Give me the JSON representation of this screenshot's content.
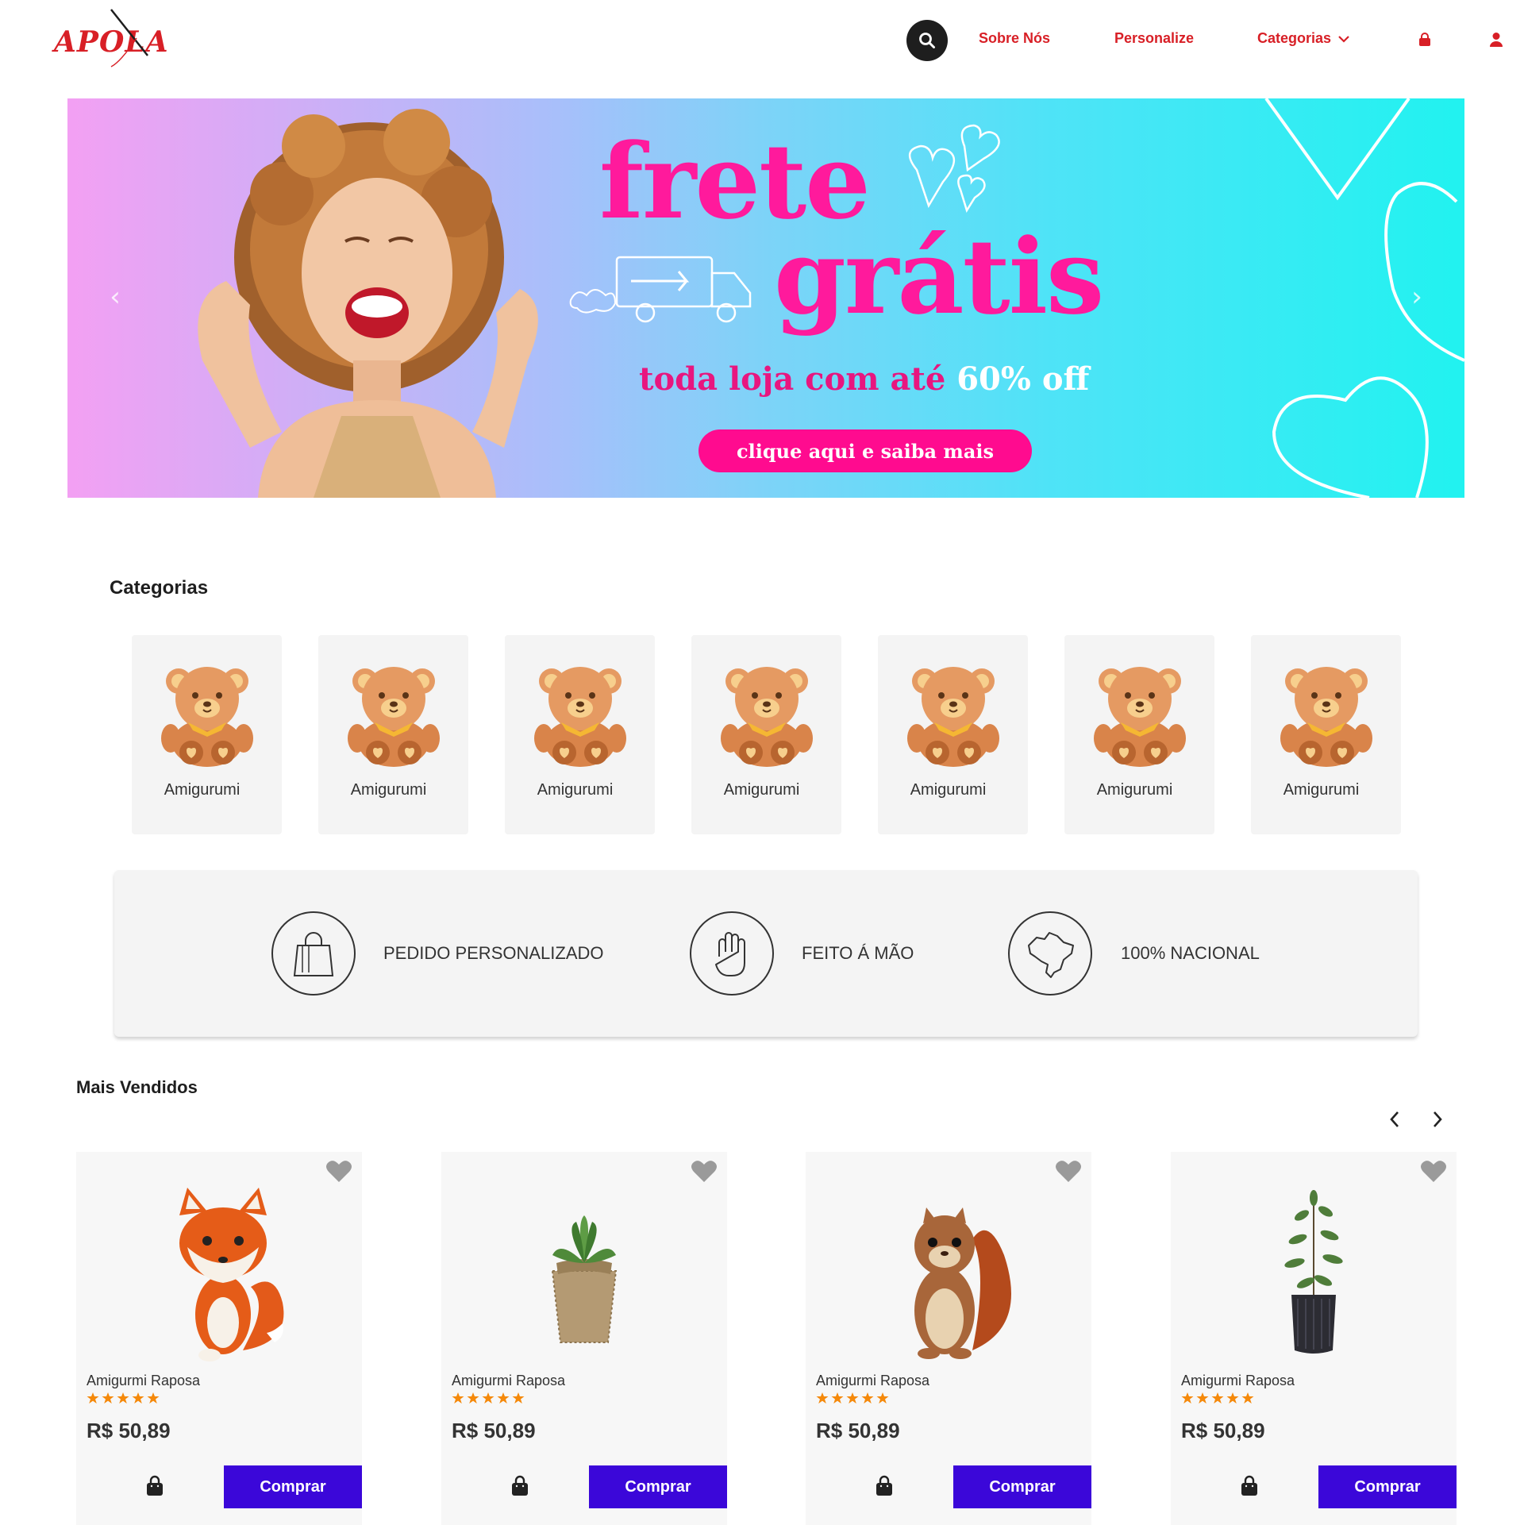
{
  "header": {
    "logo_text": "APOLA",
    "nav": {
      "about": "Sobre Nós",
      "customize": "Personalize",
      "categories": "Categorias"
    },
    "icons": [
      "search-icon",
      "cart-icon",
      "user-icon",
      "chevron-down-icon"
    ]
  },
  "banner": {
    "headline_1": "frete",
    "headline_2": "grátis",
    "subtitle_prefix": "toda loja com até ",
    "subtitle_highlight": "60% off",
    "cta": "clique aqui e saiba mais",
    "colors": {
      "pink": "#ff1a9c",
      "cyan": "#21f2f0",
      "lilac": "#f3a0f3"
    }
  },
  "categories": {
    "title": "Categorias",
    "items": [
      {
        "label": "Amigurumi"
      },
      {
        "label": "Amigurumi"
      },
      {
        "label": "Amigurumi"
      },
      {
        "label": "Amigurumi"
      },
      {
        "label": "Amigurumi"
      },
      {
        "label": "Amigurumi"
      },
      {
        "label": "Amigurumi"
      }
    ]
  },
  "features": [
    {
      "label": "PEDIDO PERSONALIZADO",
      "icon": "shopping-bag-icon"
    },
    {
      "label": "FEITO Á MÃO",
      "icon": "hand-icon"
    },
    {
      "label": "100% NACIONAL",
      "icon": "brazil-map-icon"
    }
  ],
  "best_sellers": {
    "title": "Mais Vendidos",
    "products": [
      {
        "name": "Amigurmi Raposa",
        "price": "R$ 50,89",
        "rating": 5,
        "buy": "Comprar",
        "image": "fox"
      },
      {
        "name": "Amigurmi Raposa",
        "price": "R$ 50,89",
        "rating": 5,
        "buy": "Comprar",
        "image": "succulent"
      },
      {
        "name": "Amigurmi Raposa",
        "price": "R$ 50,89",
        "rating": 5,
        "buy": "Comprar",
        "image": "squirrel"
      },
      {
        "name": "Amigurmi Raposa",
        "price": "R$ 50,89",
        "rating": 5,
        "buy": "Comprar",
        "image": "plant"
      }
    ]
  },
  "theme": {
    "brand_red": "#d81f26",
    "buy_purple": "#3b07d9",
    "star_orange": "#f5890a"
  }
}
